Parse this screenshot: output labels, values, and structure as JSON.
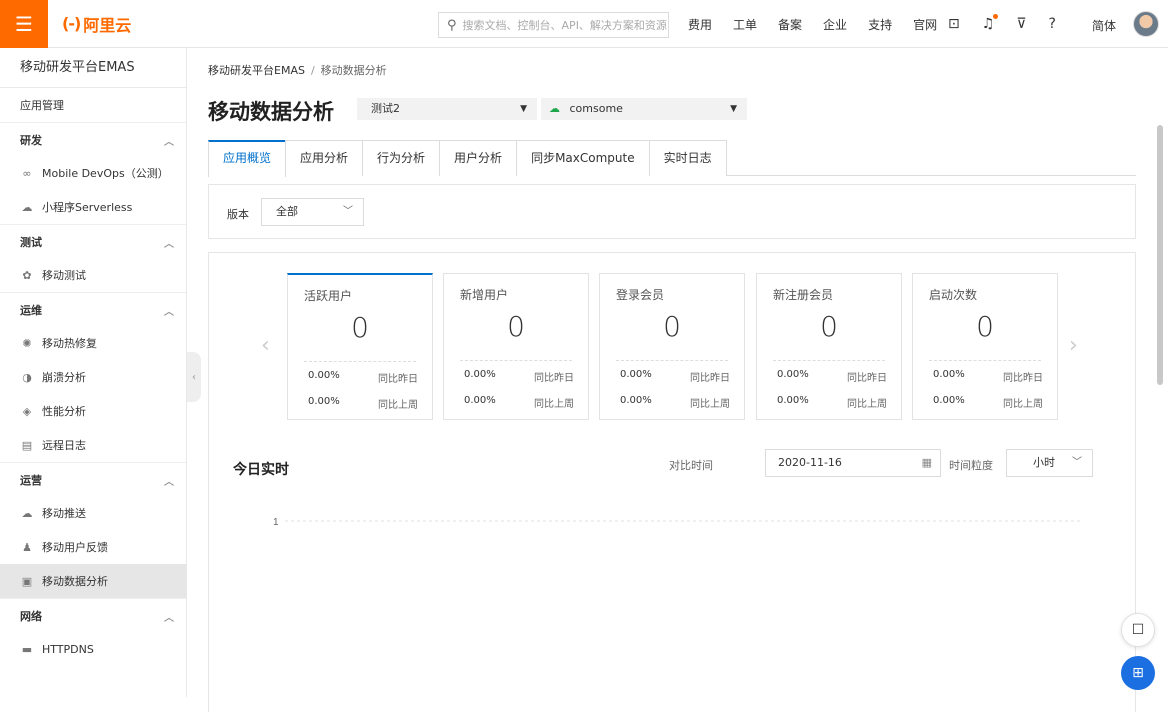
{
  "topbar": {
    "menu_icon": "hamburger-icon",
    "logo_text": "阿里云",
    "logo_bracket": "(-)",
    "search_placeholder": "搜索文档、控制台、API、解决方案和资源",
    "nav": [
      "费用",
      "工单",
      "备案",
      "企业",
      "支持",
      "官网"
    ],
    "icons": [
      "terminal-icon",
      "bell-icon",
      "cart-icon",
      "help-icon"
    ],
    "lang": "简体",
    "accent": "#ff6a00"
  },
  "sidebar": {
    "title": "移动研发平台EMAS",
    "items": [
      {
        "type": "item",
        "label": "应用管理",
        "icon": ""
      },
      {
        "type": "group",
        "label": "研发"
      },
      {
        "type": "item",
        "label": "Mobile DevOps（公测）",
        "icon": "devops-icon"
      },
      {
        "type": "item",
        "label": "小程序Serverless",
        "icon": "cloud-icon"
      },
      {
        "type": "group",
        "label": "测试"
      },
      {
        "type": "item",
        "label": "移动测试",
        "icon": "test-icon"
      },
      {
        "type": "group",
        "label": "运维"
      },
      {
        "type": "item",
        "label": "移动热修复",
        "icon": "hotfix-icon"
      },
      {
        "type": "item",
        "label": "崩溃分析",
        "icon": "crash-icon"
      },
      {
        "type": "item",
        "label": "性能分析",
        "icon": "performance-icon"
      },
      {
        "type": "item",
        "label": "远程日志",
        "icon": "log-icon"
      },
      {
        "type": "group",
        "label": "运营"
      },
      {
        "type": "item",
        "label": "移动推送",
        "icon": "push-icon"
      },
      {
        "type": "item",
        "label": "移动用户反馈",
        "icon": "feedback-icon"
      },
      {
        "type": "item",
        "label": "移动数据分析",
        "icon": "analytics-icon",
        "active": true
      },
      {
        "type": "group",
        "label": "网络"
      },
      {
        "type": "item",
        "label": "HTTPDNS",
        "icon": "dns-icon"
      }
    ]
  },
  "breadcrumb": {
    "root": "移动研发平台EMAS",
    "sep": "/",
    "current": "移动数据分析"
  },
  "page": {
    "title": "移动数据分析",
    "app_select": "测试2",
    "platform_select": "comsome"
  },
  "tabs": [
    {
      "label": "应用概览",
      "active": true
    },
    {
      "label": "应用分析"
    },
    {
      "label": "行为分析"
    },
    {
      "label": "用户分析"
    },
    {
      "label": "同步MaxCompute"
    },
    {
      "label": "实时日志"
    }
  ],
  "filter": {
    "version_label": "版本",
    "version_value": "全部"
  },
  "metrics": [
    {
      "title": "活跃用户",
      "value": "0",
      "day_pct": "0.00%",
      "day_label": "同比昨日",
      "week_pct": "0.00%",
      "week_label": "同比上周",
      "active": true
    },
    {
      "title": "新增用户",
      "value": "0",
      "day_pct": "0.00%",
      "day_label": "同比昨日",
      "week_pct": "0.00%",
      "week_label": "同比上周"
    },
    {
      "title": "登录会员",
      "value": "0",
      "day_pct": "0.00%",
      "day_label": "同比昨日",
      "week_pct": "0.00%",
      "week_label": "同比上周"
    },
    {
      "title": "新注册会员",
      "value": "0",
      "day_pct": "0.00%",
      "day_label": "同比昨日",
      "week_pct": "0.00%",
      "week_label": "同比上周"
    },
    {
      "title": "启动次数",
      "value": "0",
      "day_pct": "0.00%",
      "day_label": "同比昨日",
      "week_pct": "0.00%",
      "week_label": "同比上周"
    }
  ],
  "realtime": {
    "title": "今日实时",
    "compare_label": "对比时间",
    "compare_date": "2020-11-16",
    "granularity_label": "时间粒度",
    "granularity_value": "小时",
    "y_tick": "1"
  }
}
